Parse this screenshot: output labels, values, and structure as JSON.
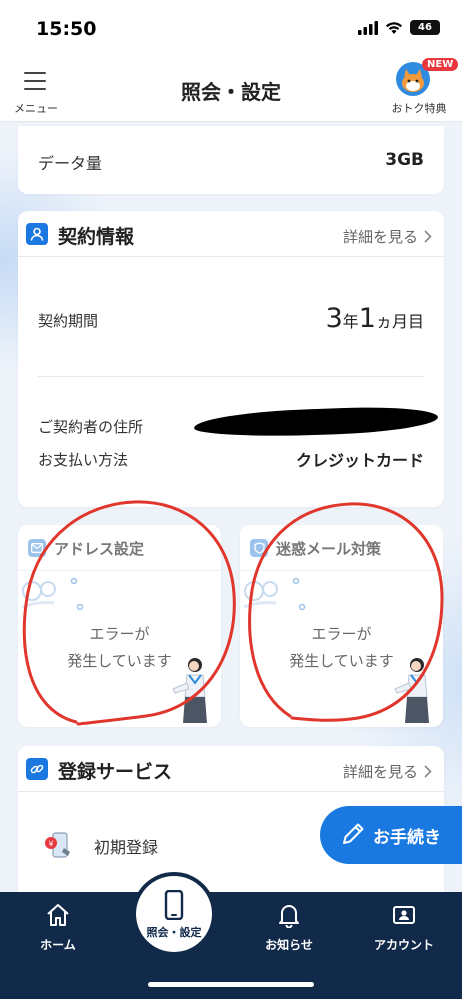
{
  "status_bar": {
    "time": "15:50",
    "battery": "46"
  },
  "header": {
    "menu_label": "メニュー",
    "title": "照会・設定",
    "perk_label": "おトク特典",
    "new_badge": "NEW"
  },
  "data_usage": {
    "label": "データ量",
    "value": "3GB"
  },
  "contract": {
    "title": "契約情報",
    "detail_link": "詳細を見る",
    "period_label": "契約期間",
    "period_years": "3",
    "period_years_unit": "年",
    "period_months": "1",
    "period_months_unit": "ヵ月目",
    "address_label": "ご契約者の住所",
    "payment_label": "お支払い方法",
    "payment_value": "クレジットカード"
  },
  "address_settings": {
    "title": "アドレス設定",
    "error_line1": "エラーが",
    "error_line2": "発生しています"
  },
  "spam_settings": {
    "title": "迷惑メール対策",
    "error_line1": "エラーが",
    "error_line2": "発生しています"
  },
  "registration": {
    "title": "登録サービス",
    "detail_link": "詳細を見る",
    "item_label": "初期登録"
  },
  "fab": {
    "label": "お手続き"
  },
  "bottom_nav": {
    "home": "ホーム",
    "settings": "照会・設定",
    "notifications": "お知らせ",
    "account": "アカウント"
  },
  "colors": {
    "accent": "#1a79e0",
    "nav_bg": "#122a4a",
    "badge": "#e8383d",
    "annotation": "#e0362c"
  }
}
